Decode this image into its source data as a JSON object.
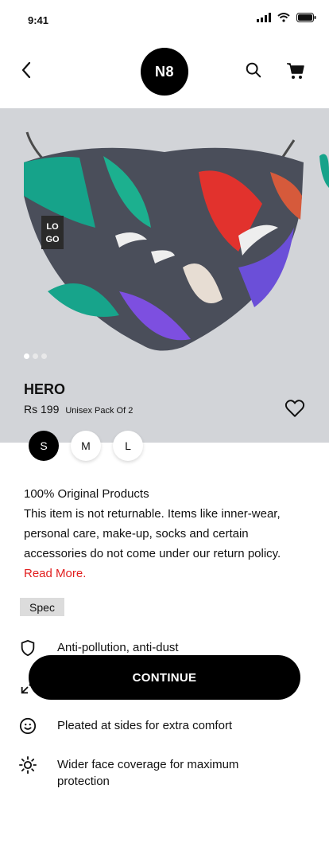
{
  "status_bar": {
    "time": "9:41"
  },
  "header": {
    "logo_text": "N8"
  },
  "product": {
    "name": "HERO",
    "price": "Rs 199",
    "pack_info": "Unisex Pack Of 2",
    "carousel": {
      "count": 3,
      "active_index": 0
    },
    "sizes": [
      {
        "label": "S",
        "selected": true
      },
      {
        "label": "M",
        "selected": false
      },
      {
        "label": "L",
        "selected": false
      }
    ]
  },
  "info": {
    "line1": "100% Original Products",
    "policy": "This item is not returnable. Items like inner-wear, personal care, make-up, socks and certain accessories do not come under our return policy.",
    "read_more": "Read More."
  },
  "spec": {
    "label": "Spec",
    "features": [
      {
        "icon": "shield-icon",
        "text": "Anti-pollution, anti-dust"
      },
      {
        "icon": "stretch-icon",
        "text": ""
      },
      {
        "icon": "smile-icon",
        "text": "Pleated at sides for extra comfort"
      },
      {
        "icon": "sun-icon",
        "text": "Wider face coverage for maximum protection"
      }
    ]
  },
  "cta": {
    "label": "CONTINUE"
  },
  "colors": {
    "accent": "#000000",
    "read_more": "#e11d1d",
    "panel_bg": "#d2d4d8"
  }
}
